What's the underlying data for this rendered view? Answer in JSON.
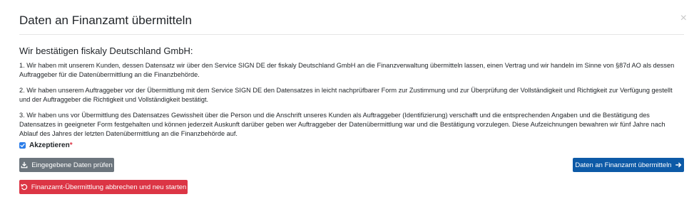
{
  "modal": {
    "title": "Daten an Finanzamt übermitteln",
    "close_label": "×"
  },
  "content": {
    "subheading": "Wir bestätigen fiskaly Deutschland GmbH:",
    "paragraphs": [
      "1. Wir haben mit unserem Kunden, dessen Datensatz wir über den Service SIGN DE der fiskaly Deutschland GmbH an die Finanzverwaltung übermitteln lassen, einen Vertrag und wir handeln im Sinne von §87d AO als dessen Auftraggeber für die Datenübermittlung an die Finanzbehörde.",
      "2. Wir haben unserem Auftraggeber vor der Übermittlung mit dem Service SIGN DE den Datensatzes in leicht nachprüfbarer Form zur Zustimmung und zur Überprüfung der Vollständigkeit und Richtigkeit zur Verfügung gestellt und der Auftraggeber die Richtigkeit und Vollständigkeit bestätigt.",
      "3. Wir haben uns vor Übermittlung des Datensatzes Gewissheit über die Person und die Anschrift unseres Kunden als Auftraggeber (Identifizierung) verschafft und die entsprechenden Angaben und die Bestätigung des Datensatzes in geeigneter Form festgehalten und können jederzeit Auskunft darüber geben wer Auftraggeber der Datenübermittlung war und die Bestätigung vorzulegen. Diese Aufzeichnungen bewahren wir fünf Jahre nach Ablauf des Jahres der letzten Datenübermittlung an die Finanzbehörde auf."
    ],
    "accept_label": "Akzeptieren",
    "required_marker": "*",
    "accept_checked": true
  },
  "buttons": {
    "check_data": "Eingegebene Daten prüfen",
    "submit": "Daten an Finanzamt übermitteln",
    "abort": "Finanzamt-Übermittlung abbrechen und neu starten"
  },
  "colors": {
    "primary": "#0d5aa7",
    "secondary": "#6c757d",
    "danger": "#dc3545",
    "checkbox": "#2b7de9"
  },
  "icons": {
    "check_data": "download-icon",
    "submit": "arrow-right-icon",
    "abort": "undo-icon",
    "close": "close-icon",
    "checkbox": "checkmark-icon"
  }
}
